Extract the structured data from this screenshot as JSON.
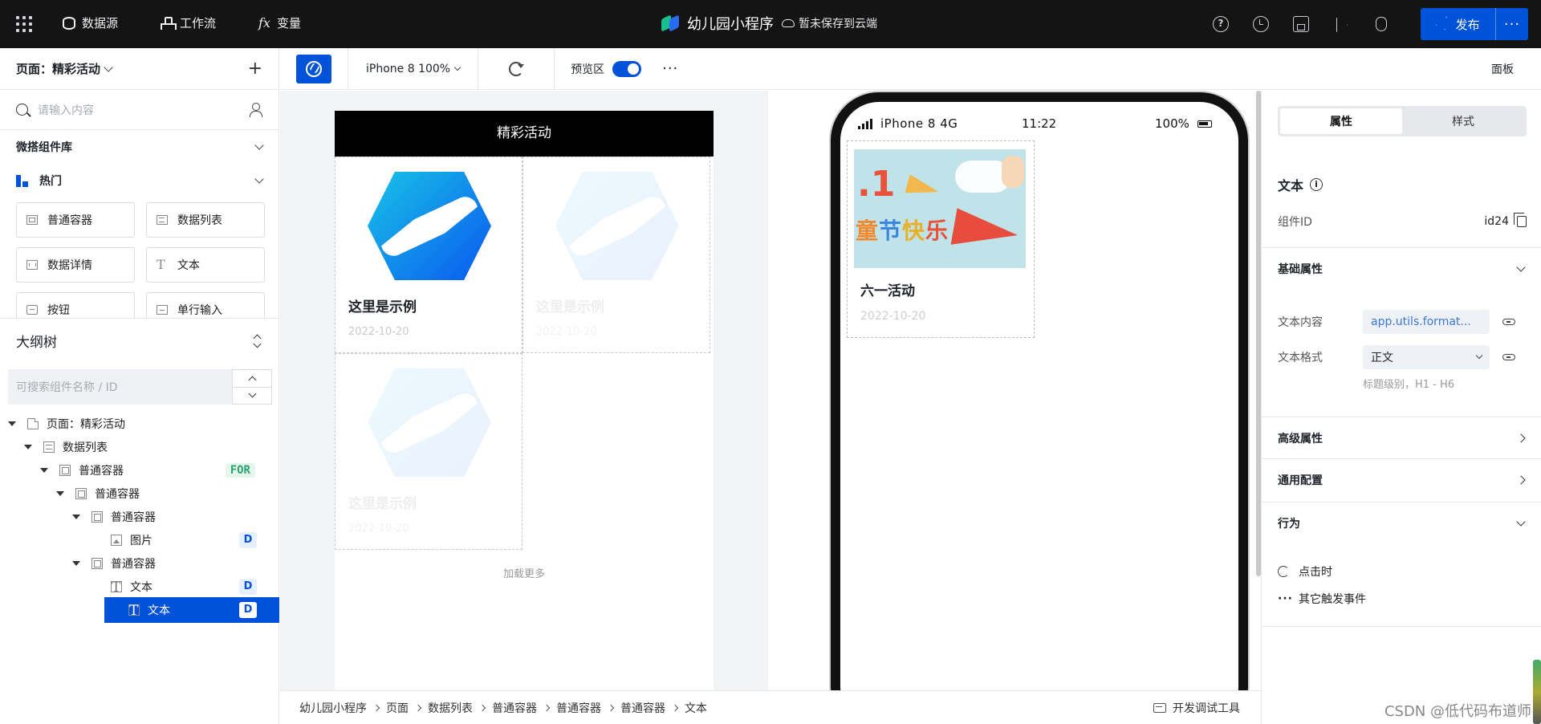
{
  "topbar": {
    "nav": [
      {
        "label": "数据源",
        "icon": "database-icon"
      },
      {
        "label": "工作流",
        "icon": "workflow-icon"
      },
      {
        "label": "变量",
        "icon": "fx-icon"
      }
    ],
    "app_name": "幼儿园小程序",
    "save_status": "暂未保存到云端",
    "publish_label": "发布",
    "more_label": "···",
    "icons": [
      "help-icon",
      "history-icon",
      "save-icon",
      "preview-run-icon",
      "debug-icon"
    ]
  },
  "left": {
    "page_selector": "页面：精彩活动",
    "add_label": "+",
    "search_placeholder": "请输入内容",
    "library_title": "微搭组件库",
    "hot_title": "热门",
    "components": [
      "普通容器",
      "数据列表",
      "数据详情",
      "文本",
      "按钮",
      "单行输入"
    ],
    "outline_title": "大纲树",
    "outline_search_placeholder": "可搜索组件名称 / ID",
    "tree": [
      {
        "label": "页面：精彩活动",
        "icon": "page-icon",
        "badge": ""
      },
      {
        "label": "数据列表",
        "icon": "list-icon",
        "badge": ""
      },
      {
        "label": "普通容器",
        "icon": "container-icon",
        "badge": "FOR"
      },
      {
        "label": "普通容器",
        "icon": "container-icon",
        "badge": ""
      },
      {
        "label": "普通容器",
        "icon": "container-icon",
        "badge": ""
      },
      {
        "label": "图片",
        "icon": "image-icon",
        "badge": "D"
      },
      {
        "label": "普通容器",
        "icon": "container-icon",
        "badge": ""
      },
      {
        "label": "文本",
        "icon": "text-icon",
        "badge": "D"
      },
      {
        "label": "文本",
        "icon": "text-icon",
        "badge": "D",
        "selected": true
      }
    ]
  },
  "toolbar": {
    "device": "iPhone 8 100%",
    "preview_label": "预览区",
    "preview_on": true,
    "more": "···",
    "panel_label": "面板"
  },
  "canvas": {
    "header": "精彩活动",
    "cards": [
      {
        "title": "这里是示例",
        "date": "2022-10-20"
      },
      {
        "title": "这里是示例",
        "date": "2022-10-20"
      },
      {
        "title": "这里是示例",
        "date": "2022-10-20"
      }
    ],
    "load_more": "加载更多"
  },
  "phone": {
    "carrier": "iPhone 8  4G",
    "time": "11:22",
    "battery": "100%",
    "item": {
      "image_num": ".1",
      "image_text": [
        "童",
        "节",
        "快",
        "乐"
      ],
      "title": "六一活动",
      "date": "2022-10-20"
    }
  },
  "breadcrumb": [
    "幼儿园小程序",
    "页面",
    "数据列表",
    "普通容器",
    "普通容器",
    "普通容器",
    "文本"
  ],
  "devtools_label": "开发调试工具",
  "right": {
    "tabs": [
      "属性",
      "样式"
    ],
    "active_tab": "属性",
    "component_title": "文本",
    "id_label": "组件ID",
    "id_value": "id24",
    "sections": {
      "basic": "基础属性",
      "advanced": "高级属性",
      "common": "通用配置",
      "behavior": "行为"
    },
    "props": {
      "text_content_label": "文本内容",
      "text_content_value": "app.utils.format...",
      "text_format_label": "文本格式",
      "text_format_value": "正文",
      "hint": "标题级别，H1 - H6"
    },
    "behaviors": [
      "点击时",
      "其它触发事件"
    ]
  },
  "watermark": "CSDN @低代码布道师",
  "colors": {
    "primary": "#0052d9",
    "topbar_bg": "#141414",
    "for_badge": "#2ba471"
  }
}
